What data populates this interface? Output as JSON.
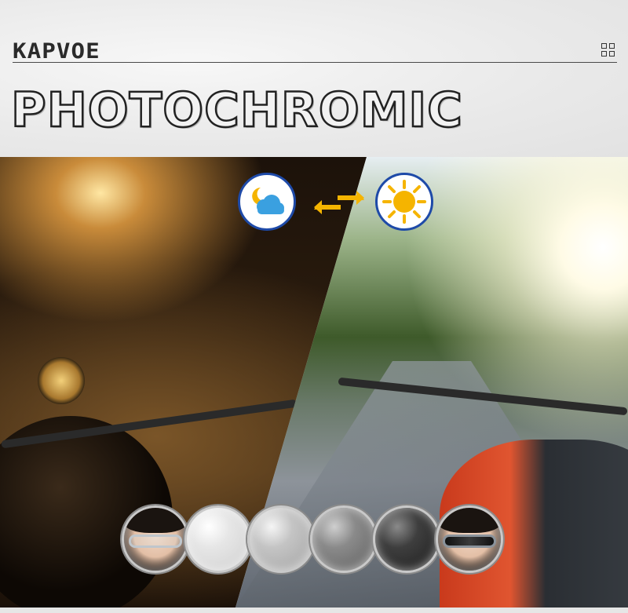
{
  "header": {
    "brand": "KAPVOE",
    "title": "PHOTOCHROMIC",
    "menu_icon": "grid-icon"
  },
  "transition": {
    "from_icon": "moon-cloud-icon",
    "to_icon": "sun-icon",
    "arrow_icon": "swap-arrows-icon",
    "accent_color": "#1e4aa8",
    "arrow_color": "#f5b400"
  },
  "lens_scale": {
    "steps": [
      {
        "name": "clear-lens-face",
        "tint": "clear"
      },
      {
        "name": "lens-tint-1",
        "tint": "#dcdcdc"
      },
      {
        "name": "lens-tint-2",
        "tint": "#b7b7b7"
      },
      {
        "name": "lens-tint-3",
        "tint": "#7e7e7e"
      },
      {
        "name": "lens-tint-4",
        "tint": "#3a3a3a"
      },
      {
        "name": "dark-lens-face",
        "tint": "dark"
      }
    ]
  }
}
